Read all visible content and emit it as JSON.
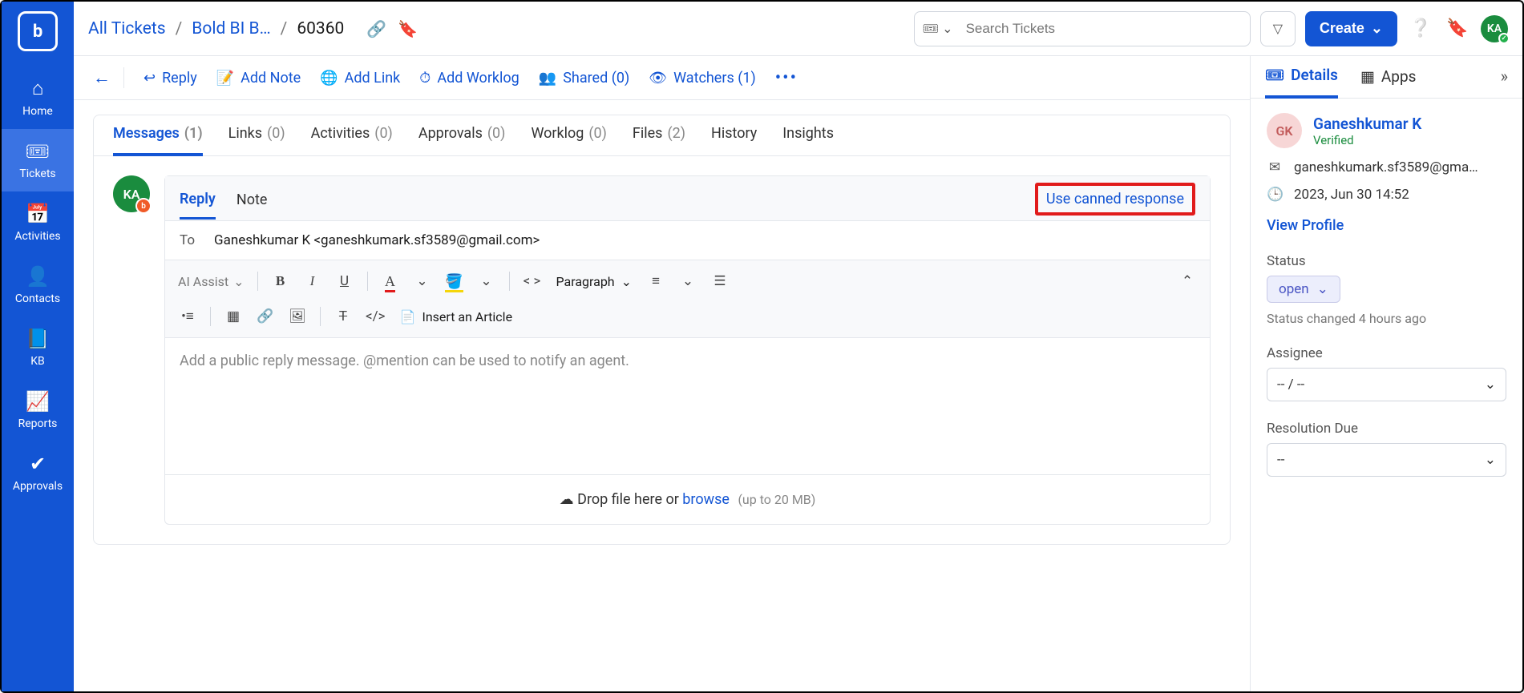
{
  "sidebar": {
    "items": [
      {
        "label": "Home",
        "icon": "⌂"
      },
      {
        "label": "Tickets",
        "icon": "🎟"
      },
      {
        "label": "Activities",
        "icon": "📅"
      },
      {
        "label": "Contacts",
        "icon": "👤"
      },
      {
        "label": "KB",
        "icon": "📘"
      },
      {
        "label": "Reports",
        "icon": "📈"
      },
      {
        "label": "Approvals",
        "icon": "✔"
      }
    ]
  },
  "breadcrumb": {
    "root": "All Tickets",
    "mid": "Bold BI B…",
    "id": "60360"
  },
  "search": {
    "placeholder": "Search Tickets"
  },
  "create_label": "Create",
  "user_initials": "KA",
  "actions": {
    "reply": "Reply",
    "add_note": "Add Note",
    "add_link": "Add Link",
    "add_worklog": "Add Worklog",
    "shared": "Shared (0)",
    "watchers": "Watchers (1)"
  },
  "tabs": {
    "messages": {
      "label": "Messages",
      "count": "(1)"
    },
    "links": {
      "label": "Links",
      "count": "(0)"
    },
    "activities": {
      "label": "Activities",
      "count": "(0)"
    },
    "approvals": {
      "label": "Approvals",
      "count": "(0)"
    },
    "worklog": {
      "label": "Worklog",
      "count": "(0)"
    },
    "files": {
      "label": "Files",
      "count": "(2)"
    },
    "history": {
      "label": "History"
    },
    "insights": {
      "label": "Insights"
    }
  },
  "compose": {
    "tab_reply": "Reply",
    "tab_note": "Note",
    "canned": "Use canned response",
    "to_label": "To",
    "to_value": "Ganeshkumar K <ganeshkumark.sf3589@gmail.com>",
    "ai_assist": "AI Assist",
    "paragraph": "Paragraph",
    "insert_article": "Insert an Article",
    "placeholder": "Add a public reply message. @mention can be used to notify an agent.",
    "drop_text": "Drop file here or ",
    "browse": "browse",
    "limit": "(up to 20 MB)"
  },
  "right": {
    "tab_details": "Details",
    "tab_apps": "Apps",
    "contact": {
      "initials": "GK",
      "name": "Ganeshkumar K",
      "verified": "Verified",
      "email": "ganeshkumark.sf3589@gma…",
      "date": "2023, Jun 30 14:52",
      "view_profile": "View Profile"
    },
    "status_label": "Status",
    "status_value": "open",
    "status_changed": "Status changed 4 hours ago",
    "assignee_label": "Assignee",
    "assignee_value": "-- / --",
    "resolution_label": "Resolution Due",
    "resolution_value": "--"
  }
}
